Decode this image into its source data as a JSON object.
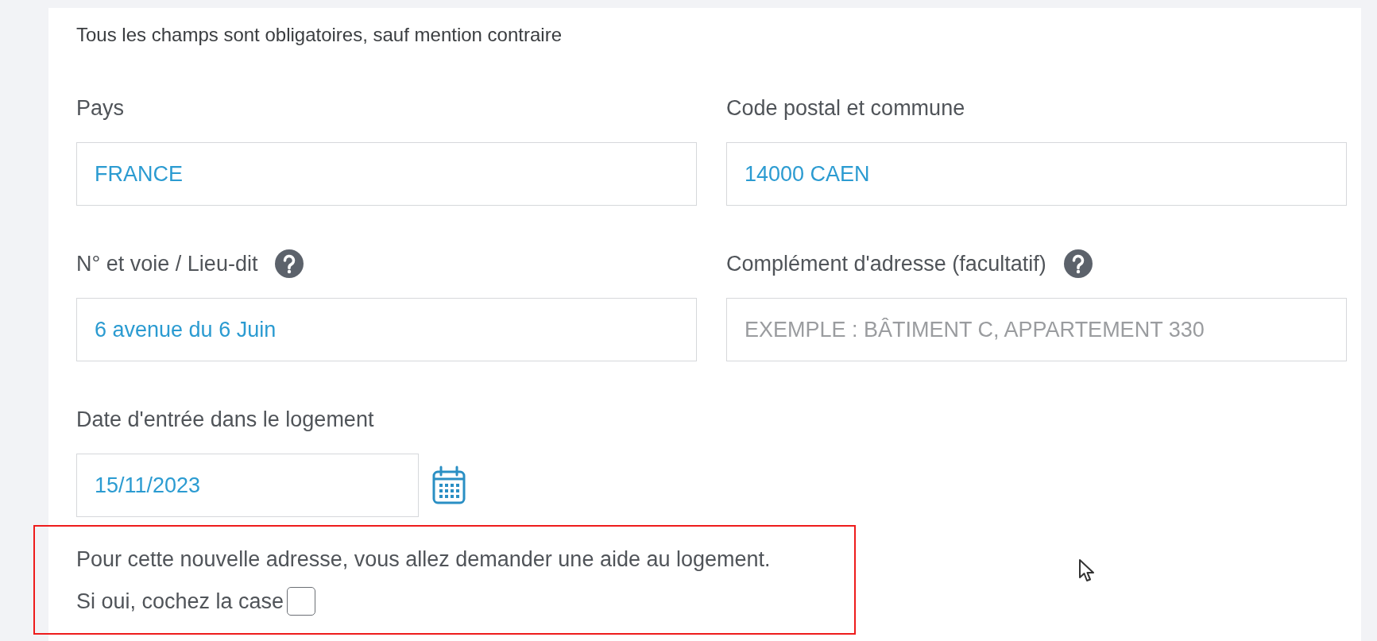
{
  "note": "Tous les champs sont obligatoires, sauf mention contraire",
  "fields": [
    {
      "label": "Pays",
      "value": "FRANCE",
      "help": false
    },
    {
      "label": "Code postal et commune",
      "value": "14000 CAEN",
      "help": false
    },
    {
      "label": "N° et voie / Lieu-dit",
      "value": "6 avenue du 6 Juin",
      "help": true
    },
    {
      "label": "Complément d'adresse (facultatif)",
      "placeholder": "EXEMPLE : BÂTIMENT C, APPARTEMENT 330",
      "help": true
    }
  ],
  "date_field": {
    "label": "Date d'entrée dans le logement",
    "value": "15/11/2023"
  },
  "housing_aid": {
    "question": "Pour cette nouvelle adresse, vous allez demander une aide au logement.",
    "checkbox_label": "Si oui, cochez la case",
    "checked": false,
    "highlighted": true
  }
}
